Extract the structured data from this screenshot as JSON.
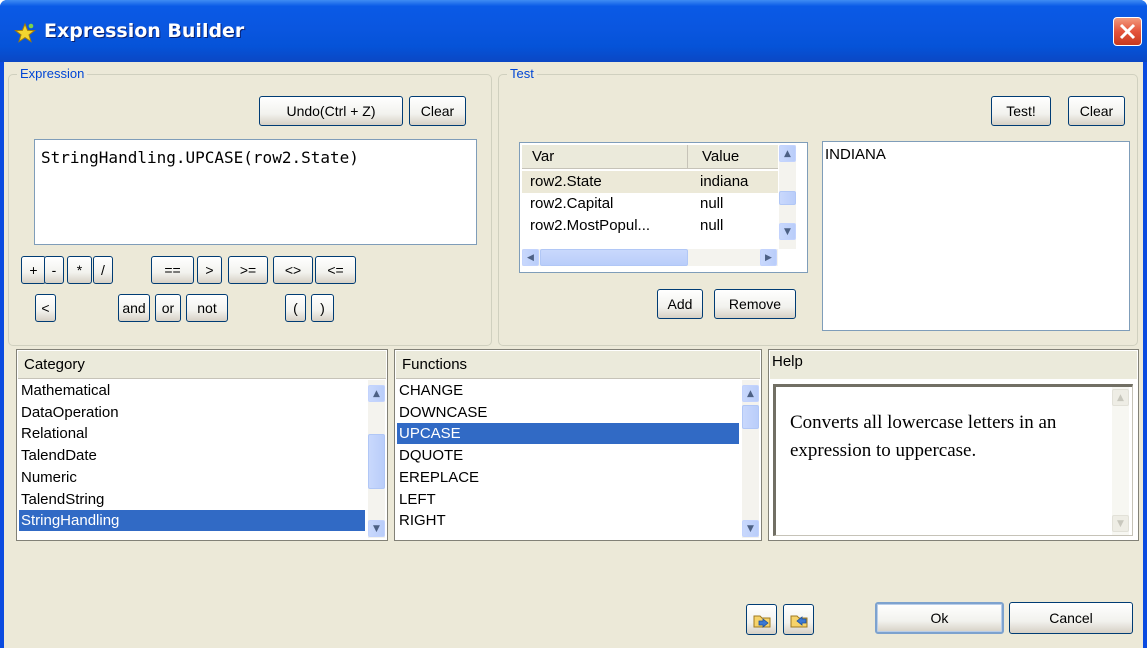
{
  "window": {
    "title": "Expression Builder"
  },
  "expression": {
    "group_title": "Expression",
    "undo_label": "Undo(Ctrl + Z)",
    "clear_label": "Clear",
    "text": "StringHandling.UPCASE(row2.State)",
    "operators_row1": [
      "+",
      "-",
      "*",
      "/",
      "==",
      ">",
      ">=",
      "<>",
      "<="
    ],
    "operators_row2": [
      "<",
      "and",
      "or",
      "not",
      "(",
      ")"
    ]
  },
  "test": {
    "group_title": "Test",
    "test_label": "Test!",
    "clear_label": "Clear",
    "columns": [
      "Var",
      "Value"
    ],
    "rows": [
      {
        "var": "row2.State",
        "value": "indiana"
      },
      {
        "var": "row2.Capital",
        "value": "null"
      },
      {
        "var": "row2.MostPopul...",
        "value": "null"
      }
    ],
    "add_label": "Add",
    "remove_label": "Remove",
    "result": "INDIANA"
  },
  "category": {
    "header": "Category",
    "items": [
      "Mathematical",
      "DataOperation",
      "Relational",
      "TalendDate",
      "Numeric",
      "TalendString",
      "StringHandling"
    ],
    "selected": "StringHandling"
  },
  "functions": {
    "header": "Functions",
    "items": [
      "CHANGE",
      "DOWNCASE",
      "UPCASE",
      "DQUOTE",
      "EREPLACE",
      "LEFT",
      "RIGHT"
    ],
    "selected": "UPCASE"
  },
  "help": {
    "header": "Help",
    "text": "Converts all lowercase letters in an expression to uppercase."
  },
  "footer": {
    "ok_label": "Ok",
    "cancel_label": "Cancel",
    "import_icon": "import-folder-icon",
    "export_icon": "export-folder-icon"
  },
  "colors": {
    "titlebar": "#0a56e0",
    "selection": "#316ac5",
    "dialog_bg": "#ece9d8",
    "group_title": "#0046d5"
  }
}
